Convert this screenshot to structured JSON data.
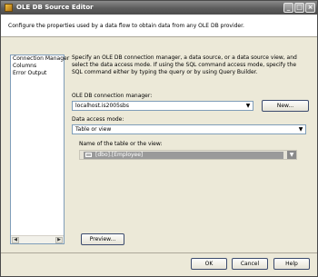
{
  "window": {
    "title": "OLE DB Source Editor",
    "controls": {
      "minimize": "_",
      "maximize": "□",
      "close": "×"
    }
  },
  "header": {
    "text": "Configure the properties used by a data flow to obtain data from any OLE DB provider."
  },
  "nav": {
    "items": [
      "Connection Manager",
      "Columns",
      "Error Output"
    ],
    "selected": "Connection Manager"
  },
  "main": {
    "description": "Specify an OLE DB connection manager, a data source, or a data source view, and select the data access mode. If using the SQL command access mode, specify the SQL command either by typing the query or by using Query Builder.",
    "connection_label": "OLE DB connection manager:",
    "connection_value": "localhost.is2005sbs",
    "new_button": "New...",
    "access_mode_label": "Data access mode:",
    "access_mode_value": "Table or view",
    "table_label": "Name of the table or the view:",
    "table_value": "[dbo].[Employee]",
    "preview_button": "Preview..."
  },
  "footer": {
    "ok": "OK",
    "cancel": "Cancel",
    "help": "Help"
  },
  "icons": {
    "dropdown": "▼",
    "scroll_left": "◀",
    "scroll_right": "▶"
  }
}
